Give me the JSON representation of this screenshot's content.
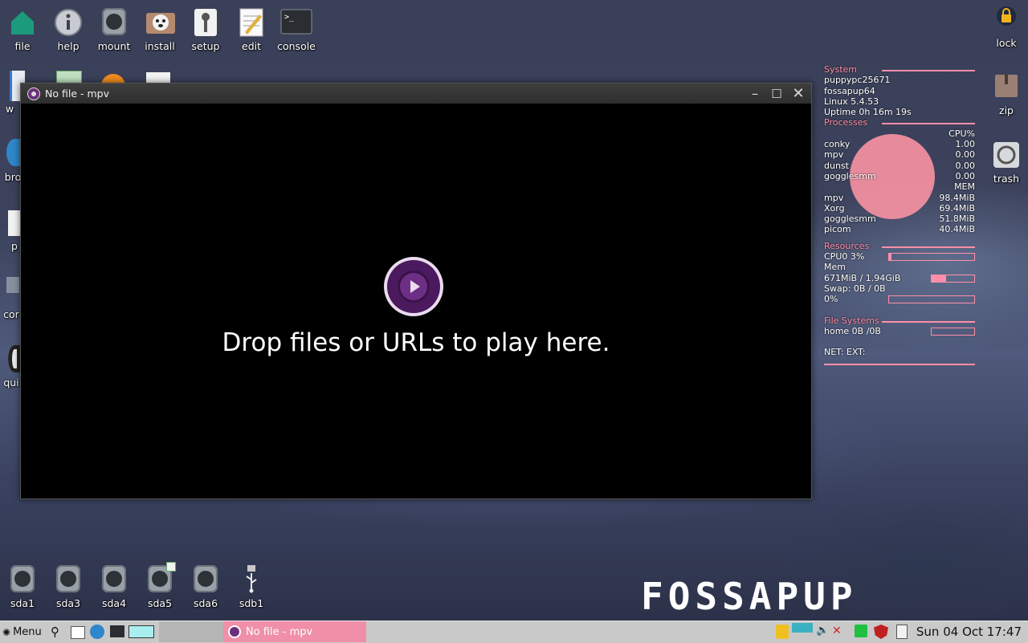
{
  "desktop": {
    "top_icons": [
      {
        "label": "file"
      },
      {
        "label": "help"
      },
      {
        "label": "mount"
      },
      {
        "label": "install"
      },
      {
        "label": "setup"
      },
      {
        "label": "edit"
      },
      {
        "label": "console"
      }
    ],
    "left_partial_labels": [
      "w",
      "bro",
      "p",
      "cor",
      "qui"
    ],
    "right_icons": [
      {
        "label": "lock"
      },
      {
        "label": "zip"
      },
      {
        "label": "trash"
      }
    ],
    "drives": [
      {
        "label": "sda1"
      },
      {
        "label": "sda3"
      },
      {
        "label": "sda4"
      },
      {
        "label": "sda5"
      },
      {
        "label": "sda6"
      },
      {
        "label": "sdb1"
      }
    ],
    "brand_text": "FOSSAPUP"
  },
  "mpv": {
    "title": "No file - mpv",
    "message": "Drop files or URLs to play here."
  },
  "conky": {
    "system_header": "System",
    "hostname": "puppypc25671",
    "distro": "fossapup64",
    "kernel": "Linux 5.4.53",
    "uptime": "Uptime 0h 16m 19s",
    "processes_header": "Processes",
    "cpu_header": "CPU%",
    "cpu_procs": [
      {
        "name": "conky",
        "value": "1.00"
      },
      {
        "name": "mpv",
        "value": "0.00"
      },
      {
        "name": "dunst",
        "value": "0.00"
      },
      {
        "name": "gogglesmm",
        "value": "0.00"
      }
    ],
    "mem_header": "MEM",
    "mem_procs": [
      {
        "name": "mpv",
        "value": "98.4MiB"
      },
      {
        "name": "Xorg",
        "value": "69.4MiB"
      },
      {
        "name": "gogglesmm",
        "value": "51.8MiB"
      },
      {
        "name": "picom",
        "value": "40.4MiB"
      }
    ],
    "resources_header": "Resources",
    "cpu0": "CPU0 3%",
    "cpu0_fraction": 0.03,
    "mem_label": "Mem",
    "mem_value": "671MiB / 1.94GiB",
    "mem_fraction": 0.34,
    "swap": "Swap: 0B   / 0B",
    "swap_pct": "0%",
    "swap_fraction": 0,
    "fs_header": "File Systems",
    "fs_home": "home 0B  /0B",
    "fs_fraction": 0,
    "net": "NET: EXT:"
  },
  "taskbar": {
    "menu_label": "Menu",
    "task_title": "No file - mpv",
    "clock": "Sun 04 Oct 17:47"
  },
  "colors": {
    "accent_pink": "#f08fa8",
    "conky_pink": "#ff8fa8",
    "mpv_purple": "#6d2f86"
  }
}
